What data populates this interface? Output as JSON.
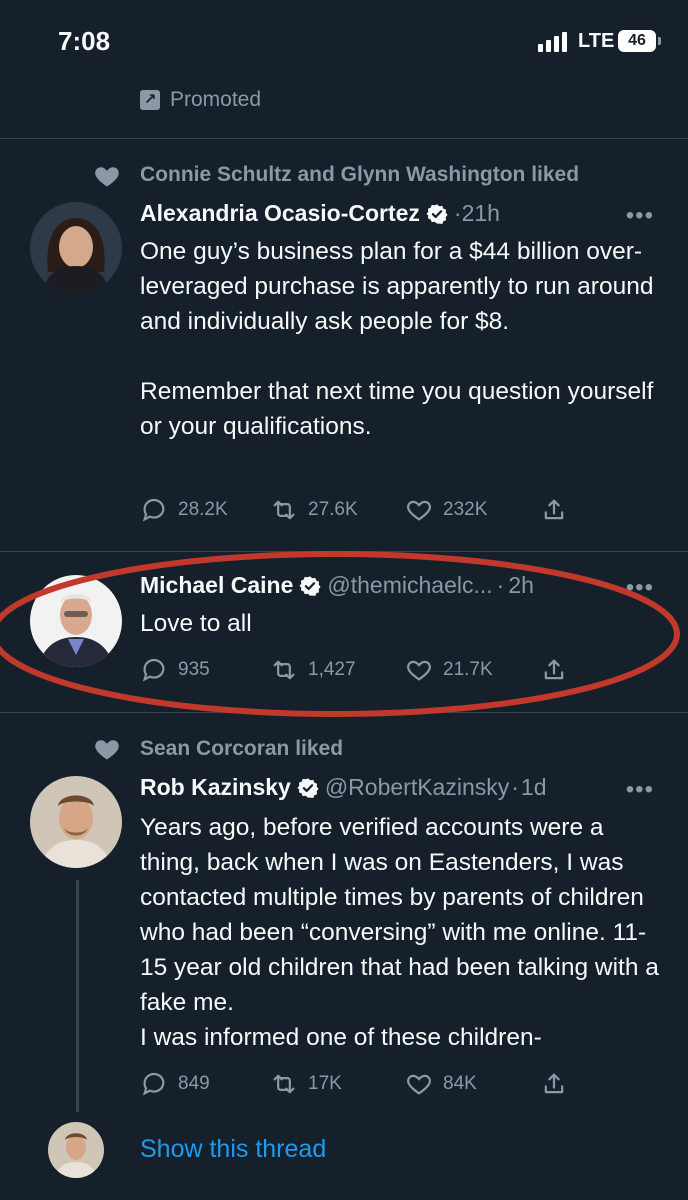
{
  "status_bar": {
    "time": "7:08",
    "network": "LTE",
    "battery": "46"
  },
  "promoted_label": "Promoted",
  "tweets": [
    {
      "context": "Connie Schultz and Glynn Washington liked",
      "name": "Alexandria Ocasio-Cortez",
      "handle": "",
      "dot": "·",
      "ago": "21h",
      "more": "•••",
      "text": "One guy’s business plan for a $44 billion over-leveraged purchase is apparently to run around and individually ask people for $8.\n\nRemember that next time you question yourself or your qualifications.",
      "replies": "28.2K",
      "retweets": "27.6K",
      "likes": "232K"
    },
    {
      "context": "",
      "name": "Michael Caine",
      "handle": "@themichaelc...",
      "dot": "·",
      "ago": "2h",
      "more": "•••",
      "text": "Love to all",
      "replies": "935",
      "retweets": "1,427",
      "likes": "21.7K"
    },
    {
      "context": "Sean Corcoran liked",
      "name": "Rob Kazinsky",
      "handle": "@RobertKazinsky",
      "dot": "·",
      "ago": "1d",
      "more": "•••",
      "text": "Years ago, before verified accounts were a thing, back when I was on Eastenders, I was contacted multiple times by parents of children who had been  “conversing” with me online. 11-15 year old children that had been talking with a fake me.\nI was informed one of these children-",
      "replies": "849",
      "retweets": "17K",
      "likes": "84K"
    }
  ],
  "show_thread": "Show this thread",
  "colors": {
    "background": "#15202b",
    "accent": "#1d9bf0",
    "muted": "#8b98a5",
    "highlight_ellipse": "#c0392b"
  }
}
